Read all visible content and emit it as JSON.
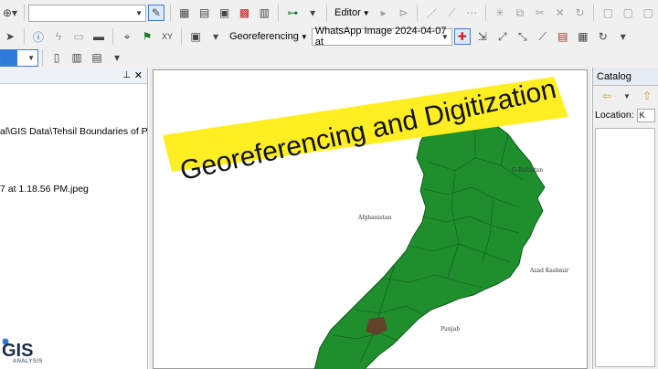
{
  "toolbar": {
    "editor_label": "Editor",
    "georeferencing_label": "Georeferencing",
    "layer_combo_value": "WhatsApp Image 2024-04-07 at",
    "scale_combo_value": "",
    "layer_selector_value": ""
  },
  "toc": {
    "path_text": "al\\GIS Data\\Tehsil Boundaries of P",
    "file_text": "7 at 1.18.56 PM.jpeg"
  },
  "catalog": {
    "title": "Catalog",
    "location_label": "Location:",
    "location_value": "K"
  },
  "map": {
    "labels": {
      "gilgit": "G-Baltistan",
      "afghanistan": "Afghanistan",
      "azad_kashmir": "Azad Kashmir",
      "punjab": "Punjab"
    }
  },
  "banner": {
    "text": "Georeferencing and Digitization"
  },
  "logo": {
    "subtitle": "ANALYSIS"
  },
  "colors": {
    "map_fill": "#1f8f2e",
    "banner_fill": "#ffee22",
    "panel_background": "#f0f0f0"
  }
}
